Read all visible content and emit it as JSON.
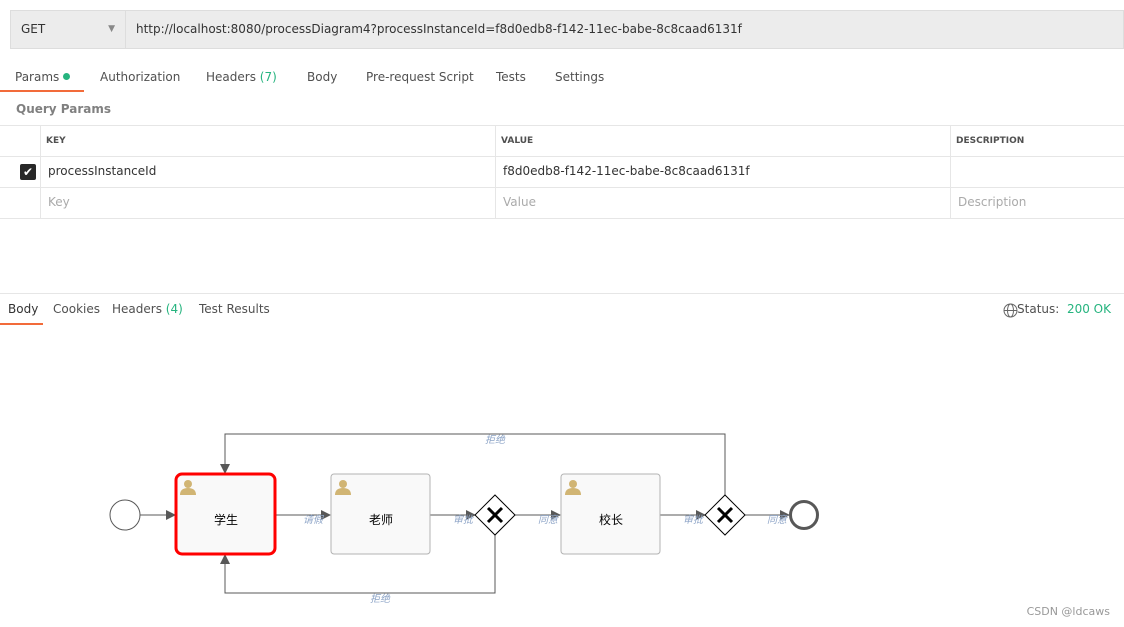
{
  "request": {
    "method": "GET",
    "url": "http://localhost:8080/processDiagram4?processInstanceId=f8d0edb8-f142-11ec-babe-8c8caad6131f"
  },
  "request_tabs": [
    {
      "label": "Params"
    },
    {
      "label": "Authorization"
    },
    {
      "label": "Headers",
      "count": "(7)"
    },
    {
      "label": "Body"
    },
    {
      "label": "Pre-request Script"
    },
    {
      "label": "Tests"
    },
    {
      "label": "Settings"
    }
  ],
  "query_params": {
    "title": "Query Params",
    "headers": [
      "KEY",
      "VALUE",
      "DESCRIPTION"
    ],
    "rows": [
      {
        "checked": true,
        "key": "processInstanceId",
        "value": "f8d0edb8-f142-11ec-babe-8c8caad6131f",
        "description": ""
      }
    ],
    "placeholder": {
      "key": "Key",
      "value": "Value",
      "description": "Description"
    }
  },
  "response_tabs": [
    {
      "label": "Body"
    },
    {
      "label": "Cookies"
    },
    {
      "label": "Headers",
      "count": "(4)"
    },
    {
      "label": "Test Results"
    }
  ],
  "status": {
    "label": "Status:",
    "value": "200 OK"
  },
  "diagram": {
    "tasks": [
      "学生",
      "老师",
      "校长"
    ],
    "flows": {
      "apply": "请假",
      "approve1": "审批",
      "agree1": "同意",
      "approve2": "审批",
      "agree2": "同意",
      "reject_top": "拒绝",
      "reject_bottom": "拒绝"
    },
    "active_task": "学生",
    "active_color": "#ff0000",
    "user_icon_color": "#d1b574"
  },
  "watermark": "CSDN @ldcaws"
}
